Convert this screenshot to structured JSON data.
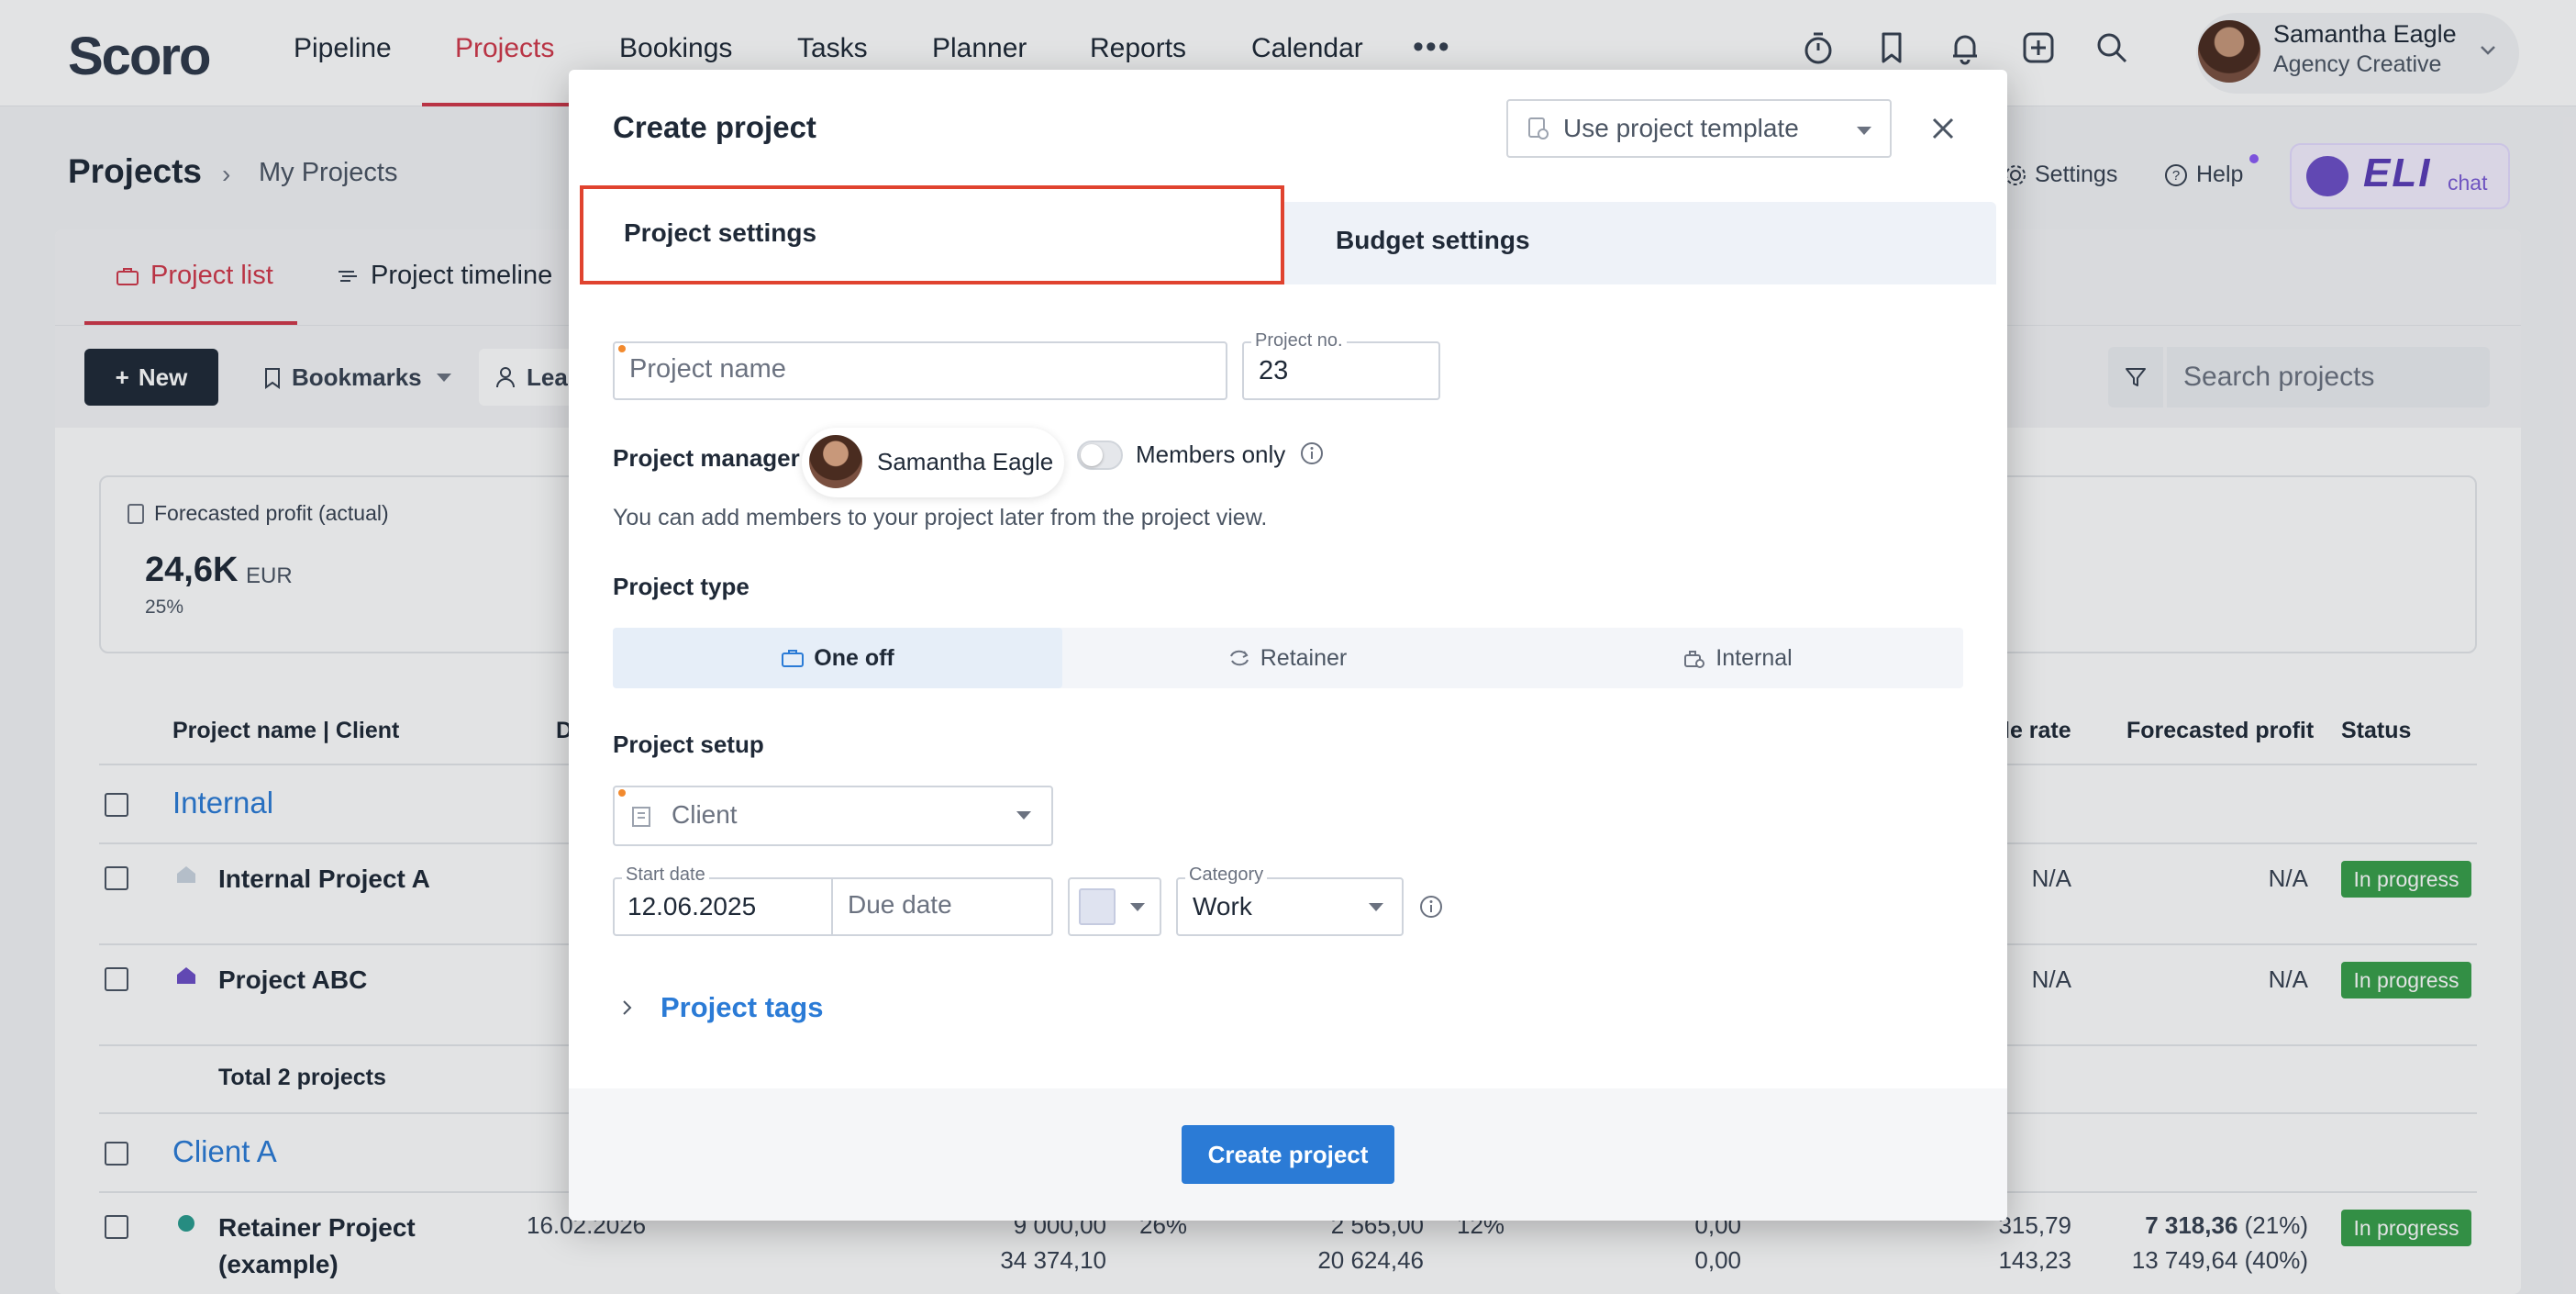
{
  "topnav": {
    "logo": "Scoro",
    "items": [
      "Pipeline",
      "Projects",
      "Bookings",
      "Tasks",
      "Planner",
      "Reports",
      "Calendar"
    ],
    "active": "Projects",
    "more": "•••",
    "icons": [
      "timer-icon",
      "bookmark-icon",
      "bell-icon",
      "add-icon",
      "search-icon"
    ]
  },
  "user": {
    "name": "Samantha Eagle",
    "role": "Agency Creative"
  },
  "page": {
    "title": "Projects",
    "breadcrumb": "My Projects",
    "settings": "Settings",
    "help": "Help",
    "eli_logo": "ELI",
    "eli_chat": "chat"
  },
  "list_tabs": [
    "Project list",
    "Project timeline"
  ],
  "toolbar": {
    "new": "New",
    "bookmarks": "Bookmarks",
    "lead": "Lea",
    "search_placeholder": "Search projects"
  },
  "stat": {
    "label": "Forecasted profit (actual)",
    "value": "24,6K",
    "unit": "EUR",
    "pct": "25%"
  },
  "table": {
    "headers": {
      "name": "Project name | Client",
      "d": "D",
      "rate": "le rate",
      "profit": "Forecasted profit",
      "status": "Status"
    },
    "groups": [
      {
        "title": "Internal",
        "rows": [
          {
            "name": "Internal Project A",
            "rate": "N/A",
            "profit": "N/A",
            "status": "In progress"
          },
          {
            "name": "Project ABC",
            "rate": "N/A",
            "profit": "N/A",
            "status": "In progress"
          }
        ],
        "total": "Total 2 projects"
      },
      {
        "title": "Client A",
        "rows": [
          {
            "name_line1": "Retainer Project",
            "name_line2": "(example)",
            "date": "16.02.2026",
            "c1a": "9 000,00",
            "c1b": "34 374,10",
            "c2": "26%",
            "c3a": "2 565,00",
            "c3b": "20 624,46",
            "c4": "12%",
            "c5a": "0,00",
            "c5b": "0,00",
            "c6a": "315,79",
            "c6b": "143,23",
            "profit_a": "7 318,36",
            "profit_a_pct": " (21%)",
            "profit_b": "13 749,64 (40%)",
            "status": "In progress"
          }
        ]
      }
    ]
  },
  "modal": {
    "title": "Create project",
    "template_placeholder": "Use project template",
    "tabs": [
      "Project settings",
      "Budget settings"
    ],
    "active_tab": "Project settings",
    "project_name_placeholder": "Project name",
    "project_no_label": "Project no.",
    "project_no_value": "23",
    "manager_label": "Project manager",
    "manager_name": "Samantha Eagle",
    "members_only_label": "Members only",
    "members_only_on": false,
    "helper_text": "You can add members to your project later from the project view.",
    "type_label": "Project type",
    "types": [
      "One off",
      "Retainer",
      "Internal"
    ],
    "active_type": "One off",
    "setup_label": "Project setup",
    "client_placeholder": "Client",
    "start_date_label": "Start date",
    "start_date_value": "12.06.2025",
    "due_date_placeholder": "Due date",
    "category_label": "Category",
    "category_value": "Work",
    "tags_label": "Project tags",
    "create_button": "Create project"
  },
  "colors": {
    "brand_red": "#d1384a",
    "link_blue": "#2b7bd6",
    "status_green": "#38a04a",
    "highlight_red": "#e0432f",
    "eli_purple": "#5b3db8"
  }
}
